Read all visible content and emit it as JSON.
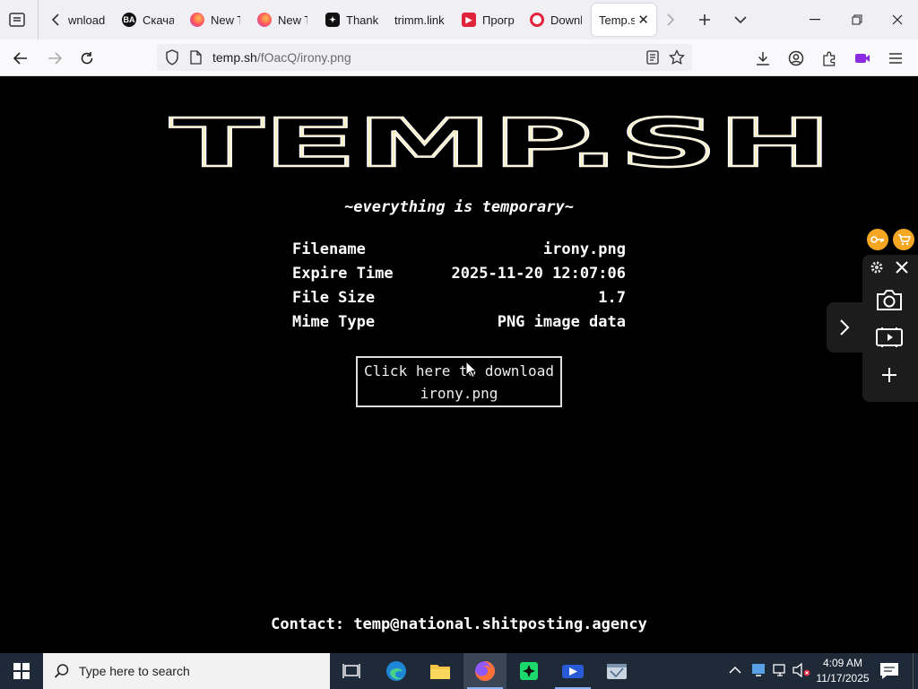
{
  "browser": {
    "tabs": [
      {
        "label": "wnload",
        "favicon": "none"
      },
      {
        "label": "Скача",
        "favicon": "ba-icon"
      },
      {
        "label": "New T",
        "favicon": "firefox-icon"
      },
      {
        "label": "New T",
        "favicon": "firefox-icon"
      },
      {
        "label": "Thank",
        "favicon": "dark-logo-icon"
      },
      {
        "label": "trimm.link",
        "favicon": "none"
      },
      {
        "label": "Прогр",
        "favicon": "video-red-icon"
      },
      {
        "label": "Downl",
        "favicon": "opera-icon"
      },
      {
        "label": "Temp.sh",
        "favicon": "none",
        "active": true
      }
    ],
    "url_host": "temp.sh",
    "url_path": "/fOacQ/irony.png"
  },
  "page": {
    "logo_text": "TEMP.SH",
    "tagline": "~everything is temporary~",
    "info": [
      {
        "label": "Filename",
        "value": "irony.png"
      },
      {
        "label": "Expire Time",
        "value": "2025-11-20 12:07:06"
      },
      {
        "label": "File Size",
        "value": "1.7"
      },
      {
        "label": "Mime Type",
        "value": "PNG image data"
      }
    ],
    "download_line1": "Click here to download",
    "download_line2": "irony.png",
    "contact_label": "Contact:",
    "contact_email": "temp@national.shitposting.agency"
  },
  "taskbar": {
    "search_placeholder": "Type here to search",
    "time": "4:09 AM",
    "date": "11/17/2025"
  },
  "colors": {
    "page_bg": "#000000",
    "text": "#ffffff",
    "accent_orange": "#f5a623",
    "taskbar_bg": "#1f2a38"
  }
}
